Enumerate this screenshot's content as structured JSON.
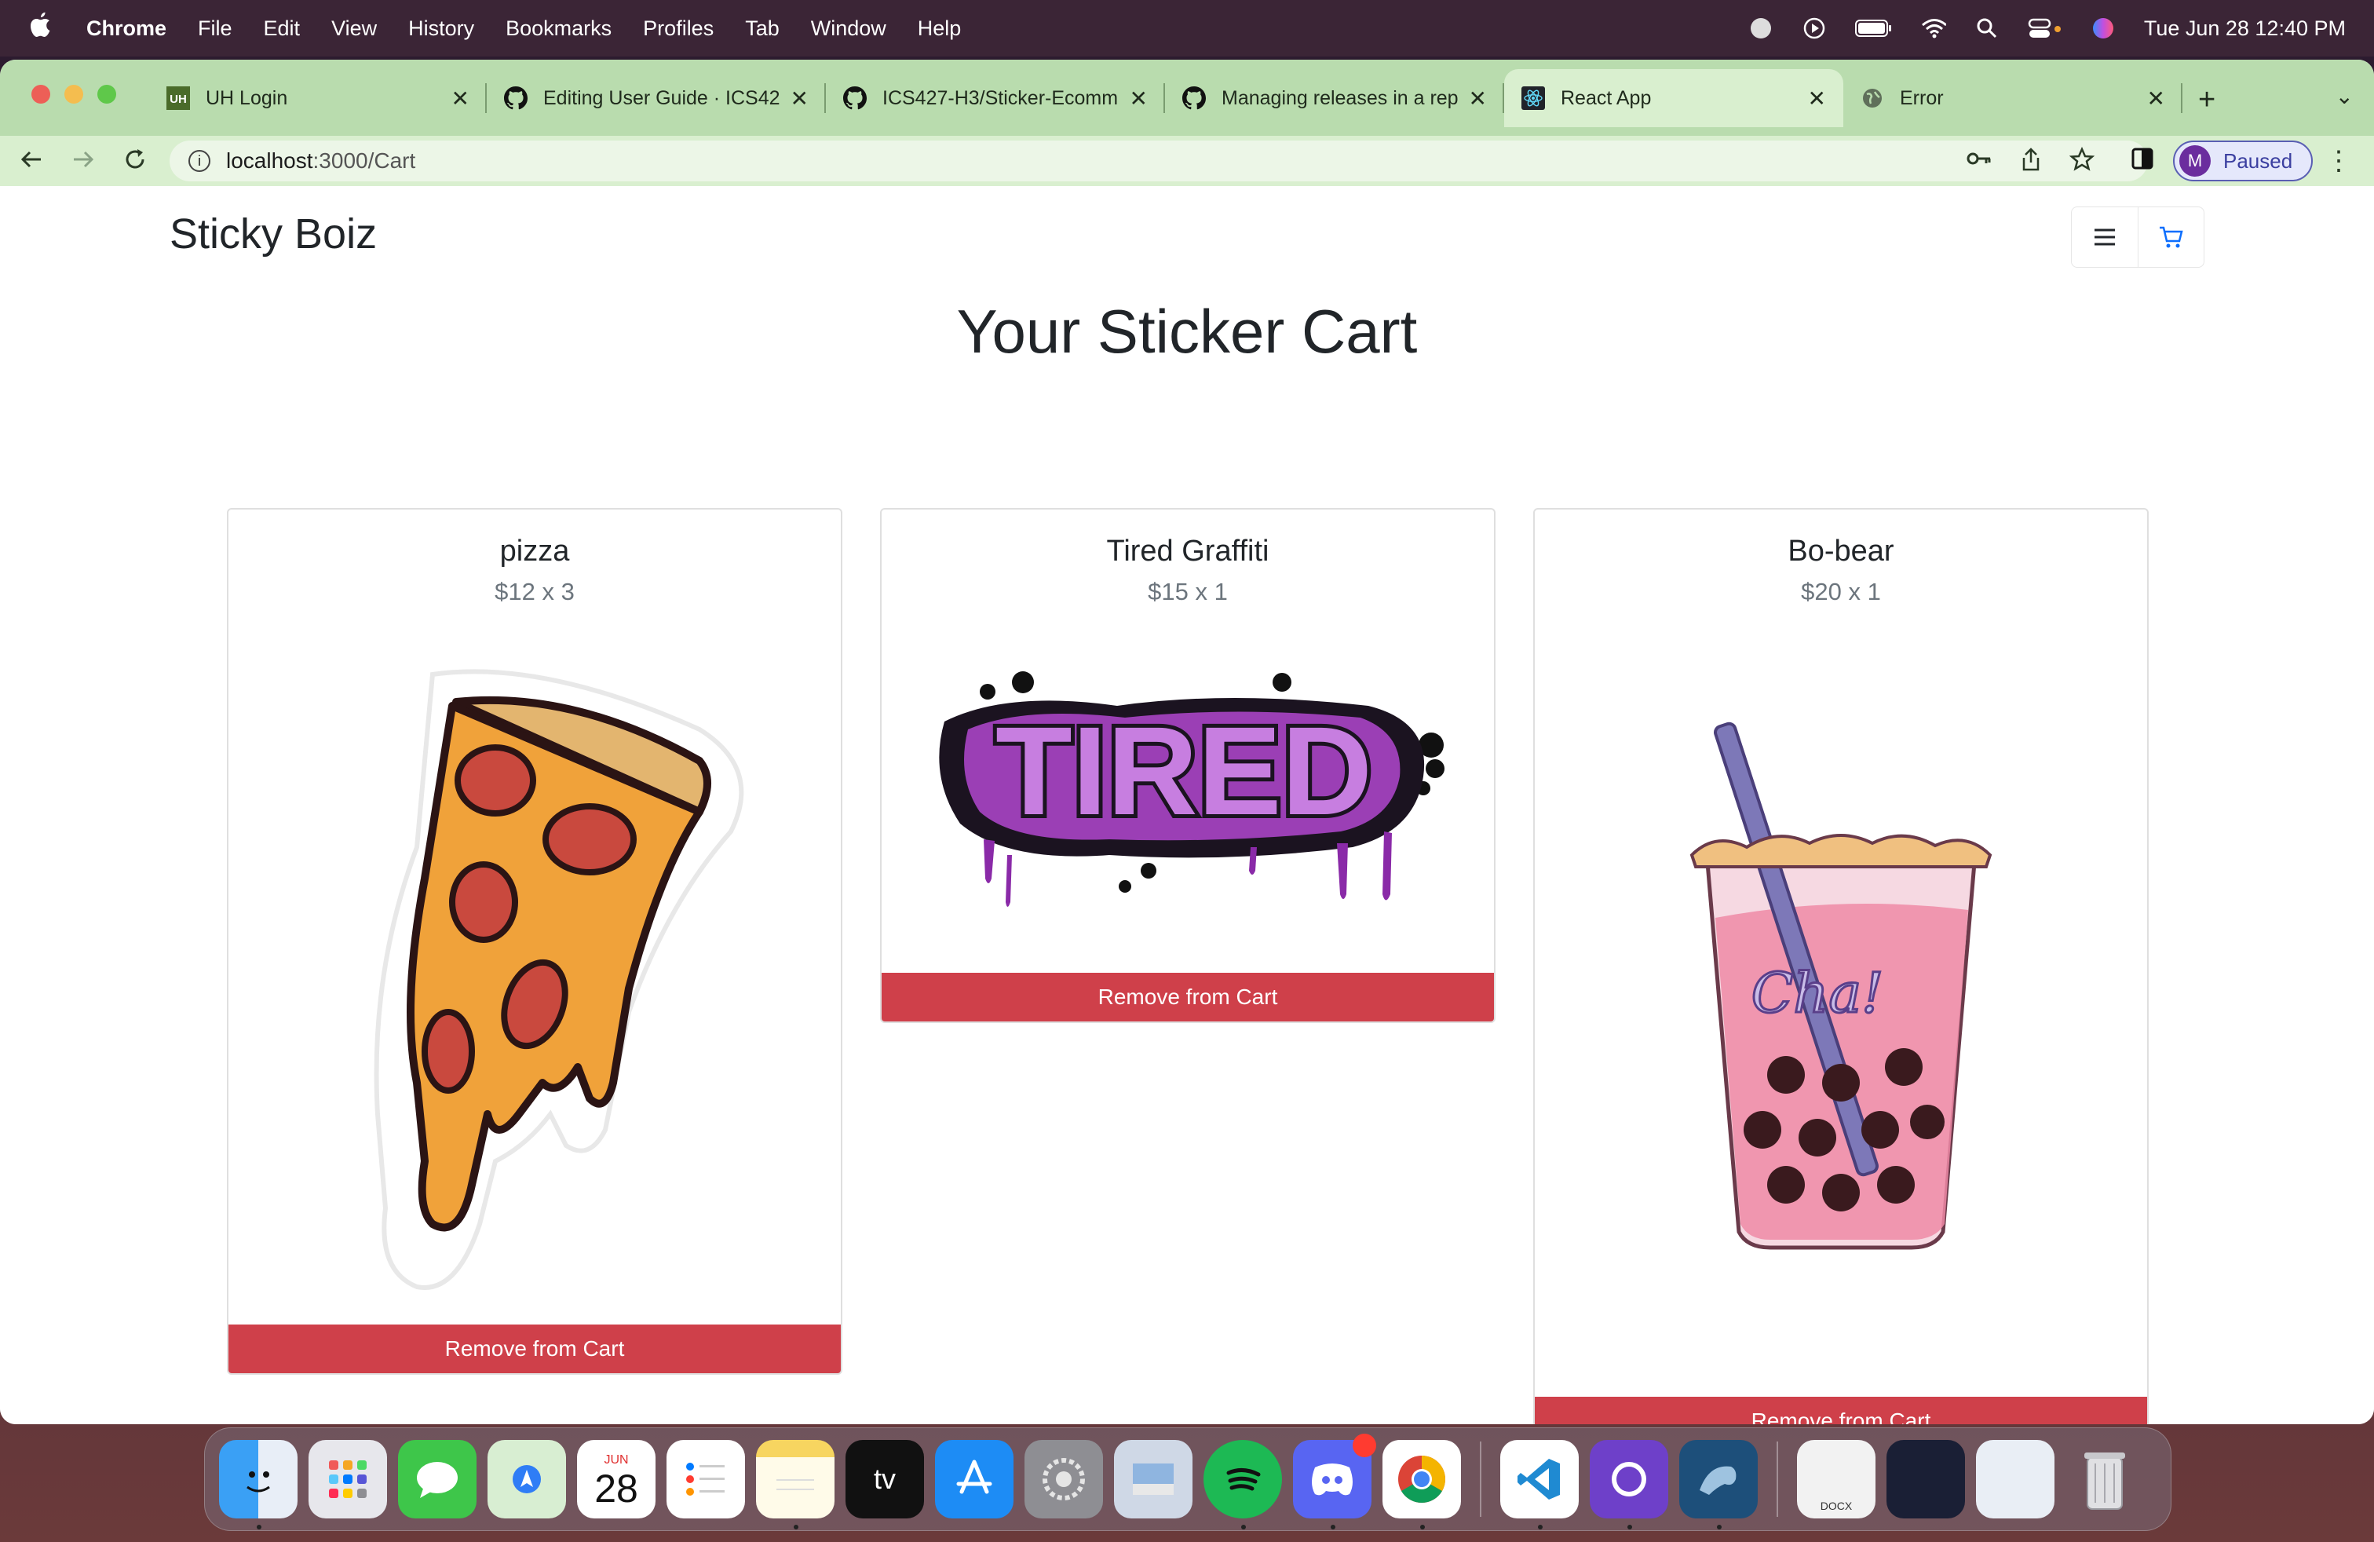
{
  "menubar": {
    "app_name": "Chrome",
    "items": [
      "File",
      "Edit",
      "View",
      "History",
      "Bookmarks",
      "Profiles",
      "Tab",
      "Window",
      "Help"
    ],
    "date_time": "Tue Jun 28  12:40 PM"
  },
  "tabs": [
    {
      "title": "UH Login",
      "favicon": "uh-icon"
    },
    {
      "title": "Editing User Guide · ICS42",
      "favicon": "github-icon"
    },
    {
      "title": "ICS427-H3/Sticker-Ecomm",
      "favicon": "github-icon"
    },
    {
      "title": "Managing releases in a rep",
      "favicon": "github-icon"
    },
    {
      "title": "React App",
      "favicon": "react-icon"
    },
    {
      "title": "Error",
      "favicon": "globe-icon"
    }
  ],
  "address_bar": {
    "host": "localhost",
    "path": ":3000/Cart"
  },
  "profile": {
    "initial": "M",
    "status": "Paused"
  },
  "site": {
    "brand": "Sticky Boiz",
    "title": "Your Sticker Cart"
  },
  "cart": [
    {
      "name": "pizza",
      "price": "$12 x 3",
      "button": "Remove from Cart"
    },
    {
      "name": "Tired Graffiti",
      "price": "$15 x 1",
      "button": "Remove from Cart",
      "art_text": "TIRED"
    },
    {
      "name": "Bo-bear",
      "price": "$20 x 1",
      "button": "Remove from Cart",
      "art_text": "Cha!"
    }
  ],
  "dock": {
    "calendar_month": "JUN",
    "calendar_day": "28",
    "tv_label": "tv",
    "doc_label": "DOCX"
  },
  "colors": {
    "tab_strip": "#b9dcae",
    "toolbar": "#d9efcf",
    "remove_button": "#cf404a"
  }
}
